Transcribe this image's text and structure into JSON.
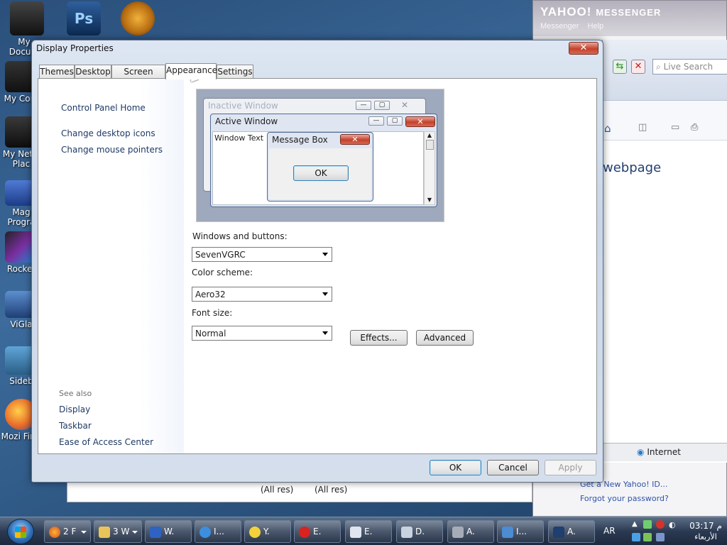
{
  "desktop": {
    "icons": [
      {
        "label": "My Docum"
      },
      {
        "label": "My Com"
      },
      {
        "label": "My Netw Plac"
      },
      {
        "label": "Mag Progra"
      },
      {
        "label": "Rocket"
      },
      {
        "label": "ViGla"
      },
      {
        "label": "Sideb"
      },
      {
        "label": "Mozi Firef"
      }
    ],
    "ps_label": "Ps"
  },
  "yahoo": {
    "brand": "YAHOO!",
    "brand_sub": "MESSENGER",
    "menu_messenger": "Messenger",
    "menu_help": "Help",
    "get_id": "Get a New Yahoo! ID...",
    "forgot": "Forgot your password?"
  },
  "ie": {
    "search_placeholder": "Live Search",
    "content_title": "webpage",
    "status_zone": "Internet"
  },
  "background_window": {
    "res1": "(All res)",
    "res2": "(All res)"
  },
  "dialog": {
    "title": "Display Properties",
    "close_glyph": "✕",
    "tabs": [
      {
        "label": "Themes"
      },
      {
        "label": "Desktop"
      },
      {
        "label": "Screen Saver"
      },
      {
        "label": "Appearance"
      },
      {
        "label": "Settings"
      }
    ],
    "left_links": {
      "home": "Control Panel Home",
      "desktop_icons": "Change desktop icons",
      "mouse_pointers": "Change mouse pointers"
    },
    "see_also": {
      "heading": "See also",
      "display": "Display",
      "taskbar": "Taskbar",
      "ease": "Ease of Access Center"
    },
    "preview": {
      "inactive": "Inactive Window",
      "active": "Active Window",
      "window_text": "Window Text",
      "message_box": "Message Box",
      "ok": "OK"
    },
    "windows_buttons_label": "Windows and buttons:",
    "windows_buttons_value": "SevenVGRC",
    "color_scheme_label": "Color scheme:",
    "color_scheme_value": "Aero32",
    "font_size_label": "Font size:",
    "font_size_value": "Normal",
    "effects_button": "Effects...",
    "advanced_button": "Advanced",
    "ok_button": "OK",
    "cancel_button": "Cancel",
    "apply_button": "Apply"
  },
  "taskbar": {
    "buttons": [
      {
        "label": "2 F"
      },
      {
        "label": "3 W"
      },
      {
        "label": "W."
      },
      {
        "label": "I..."
      },
      {
        "label": "Y."
      },
      {
        "label": "E."
      },
      {
        "label": "E."
      },
      {
        "label": "D."
      },
      {
        "label": "A."
      },
      {
        "label": "I..."
      },
      {
        "label": "A."
      }
    ],
    "lang": "AR",
    "time": "03:17",
    "ampm": "م",
    "day": "الأربعاء"
  },
  "colors": {
    "accent": "#1e3a64",
    "close_red": "#c5412b"
  }
}
